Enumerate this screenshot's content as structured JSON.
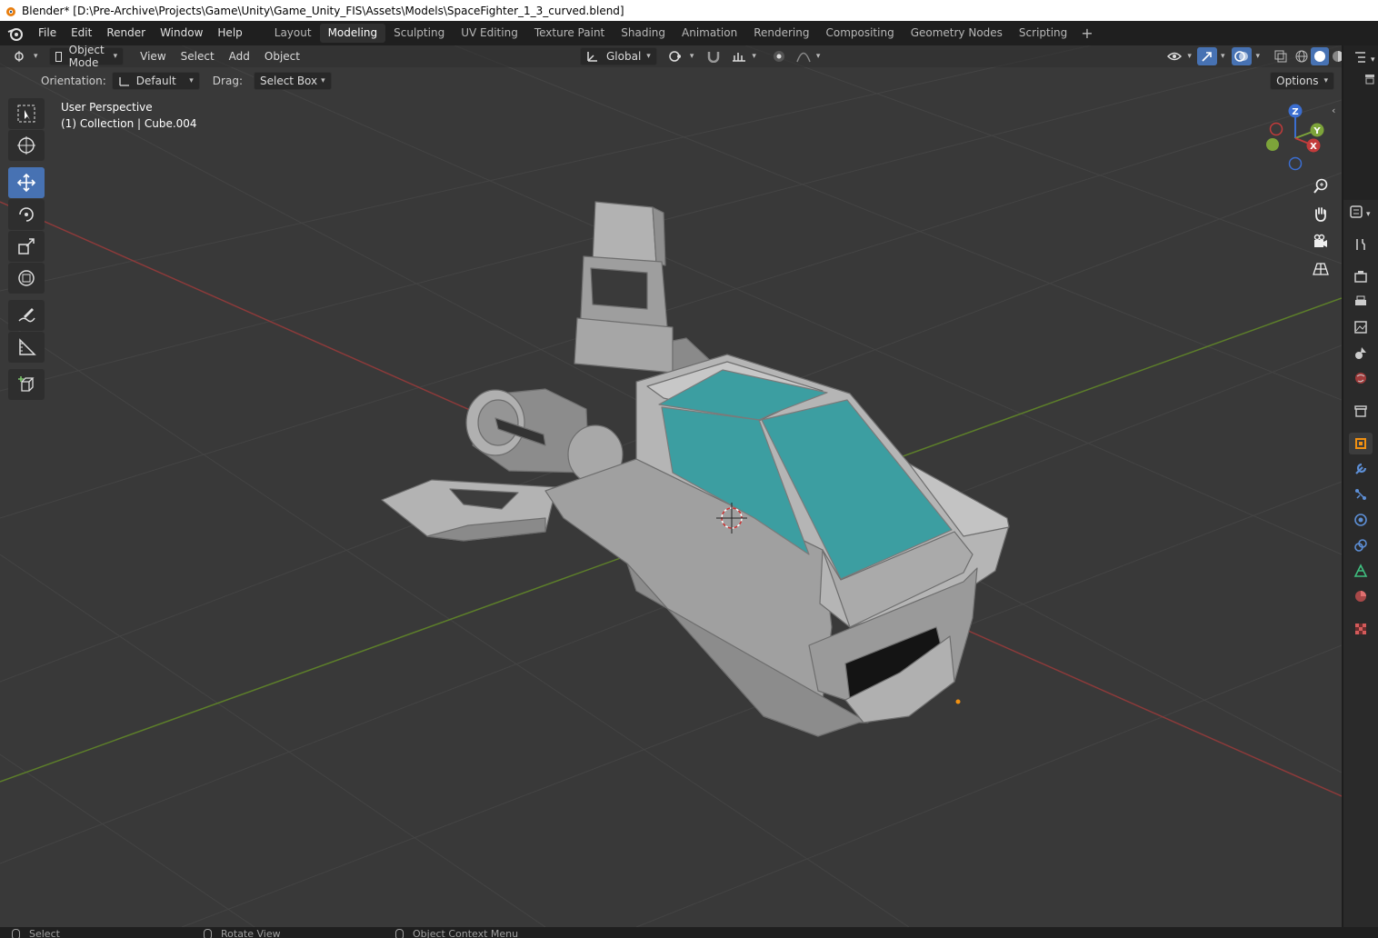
{
  "window": {
    "title": "Blender* [D:\\Pre-Archive\\Projects\\Game\\Unity\\Game_Unity_FIS\\Assets\\Models\\SpaceFighter_1_3_curved.blend]"
  },
  "menu": [
    "File",
    "Edit",
    "Render",
    "Window",
    "Help"
  ],
  "workspaces": [
    "Layout",
    "Modeling",
    "Sculpting",
    "UV Editing",
    "Texture Paint",
    "Shading",
    "Animation",
    "Rendering",
    "Compositing",
    "Geometry Nodes",
    "Scripting"
  ],
  "active_workspace": "Modeling",
  "header": {
    "mode": "Object Mode",
    "menus": [
      "View",
      "Select",
      "Add",
      "Object"
    ],
    "transform_orientation": "Global"
  },
  "tool_settings": {
    "orientation_label": "Orientation:",
    "orientation_value": "Default",
    "drag_label": "Drag:",
    "drag_value": "Select Box",
    "options": "Options"
  },
  "viewport": {
    "perspective": "User Perspective",
    "collection": "(1) Collection | Cube.004"
  },
  "gizmo": {
    "z": "Z",
    "y": "Y",
    "x": "X"
  },
  "colors": {
    "viewport_bg": "#393939",
    "x_axis": "#c23b3b",
    "y_axis": "#6b9a2c",
    "accent": "#4772b3",
    "canopy": "#3b9c9f",
    "hull": "#a8a8a8"
  },
  "status": {
    "select": "Select",
    "rotate": "Rotate View",
    "context": "Object Context Menu"
  }
}
